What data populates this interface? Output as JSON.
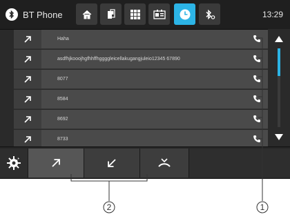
{
  "header": {
    "title": "BT Phone",
    "time": "13:29",
    "buttons": [
      {
        "icon": "home-icon"
      },
      {
        "icon": "phone-device-icon"
      },
      {
        "icon": "grid-icon"
      },
      {
        "icon": "contacts-card-icon"
      },
      {
        "icon": "clock-icon",
        "active": true
      },
      {
        "icon": "bluetooth-settings-icon"
      }
    ]
  },
  "list": {
    "rows": [
      {
        "direction": "outgoing",
        "name": "Haha"
      },
      {
        "direction": "outgoing",
        "name": "asdfhjkooojhgfhhffhggggleicellakugangjuleio12345 67890"
      },
      {
        "direction": "outgoing",
        "name": "8077"
      },
      {
        "direction": "outgoing",
        "name": "8584"
      },
      {
        "direction": "outgoing",
        "name": "8692"
      },
      {
        "direction": "outgoing",
        "name": "8733"
      }
    ]
  },
  "tabs": [
    {
      "icon": "settings-gear-icon"
    },
    {
      "icon": "outgoing-call-icon",
      "selected": true
    },
    {
      "icon": "incoming-call-icon"
    },
    {
      "icon": "missed-call-icon"
    },
    {
      "icon": ""
    }
  ],
  "callouts": {
    "label_1": "1",
    "label_2": "2"
  },
  "colors": {
    "accent": "#2cb4e6",
    "row_bg": "#4a4a4a",
    "bar_bg": "#1f1f1f"
  }
}
